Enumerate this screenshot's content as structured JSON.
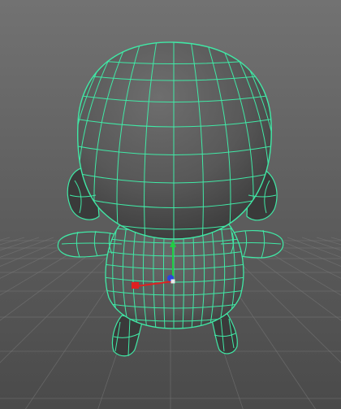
{
  "viewport": {
    "background_top": "#727272",
    "background_bottom": "#4a4a4a",
    "grid_color": "#7c7c7c",
    "mesh_fill": "#555555",
    "mesh_fill_shadow": "#3a3a3a",
    "mesh_fill_light": "#6a6a6a",
    "wireframe_color": "#40e9a6"
  },
  "manipulator": {
    "icon": "move-manipulator-icon",
    "x_axis_color": "#e02020",
    "y_axis_color": "#22cc44",
    "z_axis_color": "#2a45e0",
    "center_color": "#e8e8e8"
  },
  "model": {
    "icon": "cartoon-character-mesh-icon",
    "selected": true
  }
}
